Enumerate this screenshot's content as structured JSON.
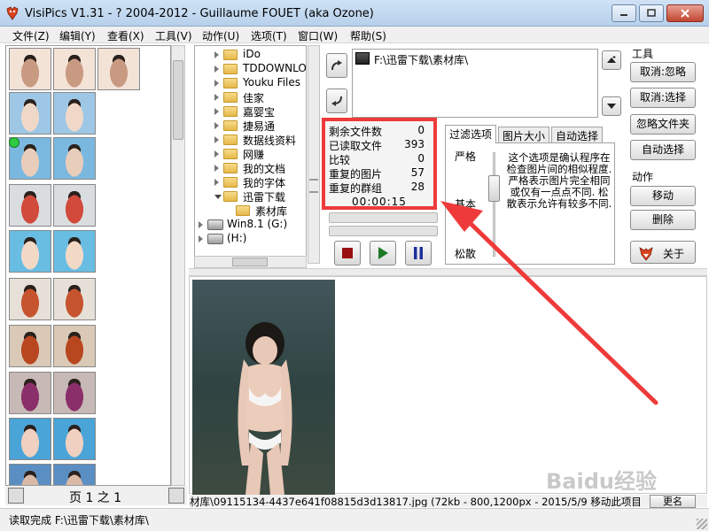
{
  "window": {
    "title": "VisiPics V1.31 - ? 2004-2012 - Guillaume FOUET (aka Ozone)"
  },
  "menu": [
    "文件(Z)",
    "编辑(Y)",
    "查看(X)",
    "工具(V)",
    "动作(U)",
    "选项(T)",
    "窗口(W)",
    "帮助(S)"
  ],
  "pager": {
    "label": "页 1 之 1"
  },
  "tree": {
    "items": [
      {
        "label": "iDo",
        "type": "folder",
        "indent": 0,
        "open": false
      },
      {
        "label": "TDDOWNLOA",
        "type": "folder",
        "indent": 0,
        "open": false
      },
      {
        "label": "Youku Files",
        "type": "folder",
        "indent": 0,
        "open": false
      },
      {
        "label": "佳家",
        "type": "folder",
        "indent": 0,
        "open": false
      },
      {
        "label": "嘉婴宝",
        "type": "folder",
        "indent": 0,
        "open": false
      },
      {
        "label": "捷易通",
        "type": "folder",
        "indent": 0,
        "open": false
      },
      {
        "label": "数据线资料",
        "type": "folder",
        "indent": 0,
        "open": false
      },
      {
        "label": "网赚",
        "type": "folder",
        "indent": 0,
        "open": false
      },
      {
        "label": "我的文档",
        "type": "folder",
        "indent": 0,
        "open": false
      },
      {
        "label": "我的字体",
        "type": "folder",
        "indent": 0,
        "open": false
      },
      {
        "label": "迅雷下载",
        "type": "folder",
        "indent": 0,
        "open": true
      },
      {
        "label": "素材库",
        "type": "folder",
        "indent": 1,
        "open": false
      },
      {
        "label": "Win8.1 (G:)",
        "type": "drive",
        "indent": -1,
        "open": false
      },
      {
        "label": "(H:)",
        "type": "drive",
        "indent": -1,
        "open": false
      }
    ]
  },
  "directory": {
    "path": "F:\\迅雷下载\\素材库\\"
  },
  "stats": {
    "rows": [
      {
        "label": "剩余文件数",
        "value": "0"
      },
      {
        "label": "已读取文件",
        "value": "393"
      },
      {
        "label": "比较",
        "value": "0"
      },
      {
        "label": "重复的图片",
        "value": "57"
      },
      {
        "label": "重复的群组",
        "value": "28"
      }
    ],
    "timer": "00:00:15"
  },
  "tabs": [
    "过滤选项",
    "图片大小",
    "自动选择"
  ],
  "filter": {
    "levels": [
      "严格",
      "基本",
      "松散"
    ],
    "description": "这个选项是确认程序在检查图片间的相似程度. 严格表示图片完全相同或仅有一点点不同. 松散表示允许有较多不同."
  },
  "tools_group": {
    "label": "工具",
    "buttons": [
      "取消:忽略",
      "取消:选择",
      "忽略文件夹",
      "自动选择"
    ]
  },
  "actions_group": {
    "label": "动作",
    "buttons": [
      "移动",
      "删除"
    ]
  },
  "about": {
    "label": "关于"
  },
  "preview": {
    "info": "材库\\09115134-4437e641f08815d3d13817.jpg (72kb - 800,1200px - 2015/5/9 移动此项目",
    "rename_label": "更名",
    "watermark": "Baidu经验"
  },
  "status": {
    "text": "读取完成 F:\\迅雷下载\\素材库\\"
  }
}
